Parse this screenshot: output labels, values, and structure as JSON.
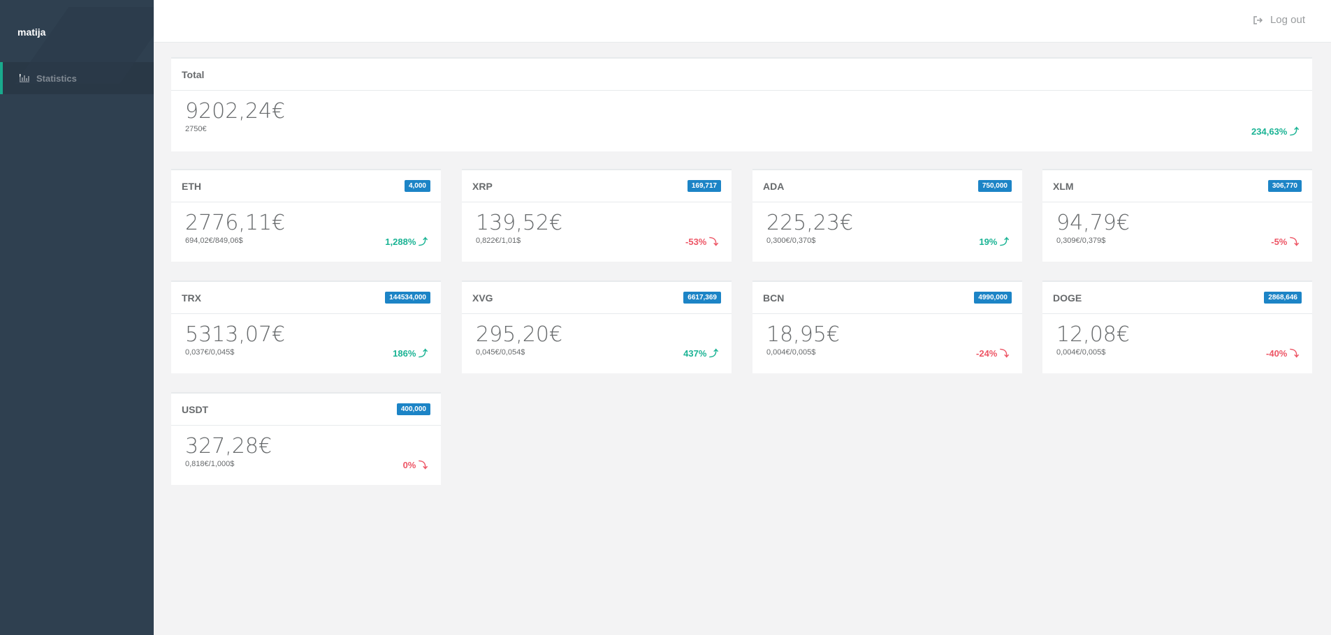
{
  "user": {
    "name": "matija"
  },
  "nav": {
    "items": [
      {
        "label": "Statistics",
        "icon": "bar-chart-icon"
      }
    ]
  },
  "topbar": {
    "logout_label": "Log out",
    "logout_icon": "sign-out-icon"
  },
  "total": {
    "title": "Total",
    "value": "9202,24€",
    "invested": "2750€",
    "change": "234,63%",
    "direction": "up"
  },
  "coins": [
    {
      "symbol": "ETH",
      "amount": "4,000",
      "value": "2776,11€",
      "price": "694,02€/849,06$",
      "change": "1,288%",
      "direction": "up"
    },
    {
      "symbol": "XRP",
      "amount": "169,717",
      "value": "139,52€",
      "price": "0,822€/1,01$",
      "change": "-53%",
      "direction": "down"
    },
    {
      "symbol": "ADA",
      "amount": "750,000",
      "value": "225,23€",
      "price": "0,300€/0,370$",
      "change": "19%",
      "direction": "up"
    },
    {
      "symbol": "XLM",
      "amount": "306,770",
      "value": "94,79€",
      "price": "0,309€/0,379$",
      "change": "-5%",
      "direction": "down"
    },
    {
      "symbol": "TRX",
      "amount": "144534,000",
      "value": "5313,07€",
      "price": "0,037€/0,045$",
      "change": "186%",
      "direction": "up"
    },
    {
      "symbol": "XVG",
      "amount": "6617,369",
      "value": "295,20€",
      "price": "0,045€/0,054$",
      "change": "437%",
      "direction": "up"
    },
    {
      "symbol": "BCN",
      "amount": "4990,000",
      "value": "18,95€",
      "price": "0,004€/0,005$",
      "change": "-24%",
      "direction": "down"
    },
    {
      "symbol": "DOGE",
      "amount": "2868,646",
      "value": "12,08€",
      "price": "0,004€/0,005$",
      "change": "-40%",
      "direction": "down"
    },
    {
      "symbol": "USDT",
      "amount": "400,000",
      "value": "327,28€",
      "price": "0,818€/1,000$",
      "change": "0%",
      "direction": "down"
    }
  ],
  "colors": {
    "sidebar": "#2f4050",
    "accent": "#19aa8d",
    "up": "#1ab394",
    "down": "#ed5565",
    "badge": "#1c84c6"
  }
}
